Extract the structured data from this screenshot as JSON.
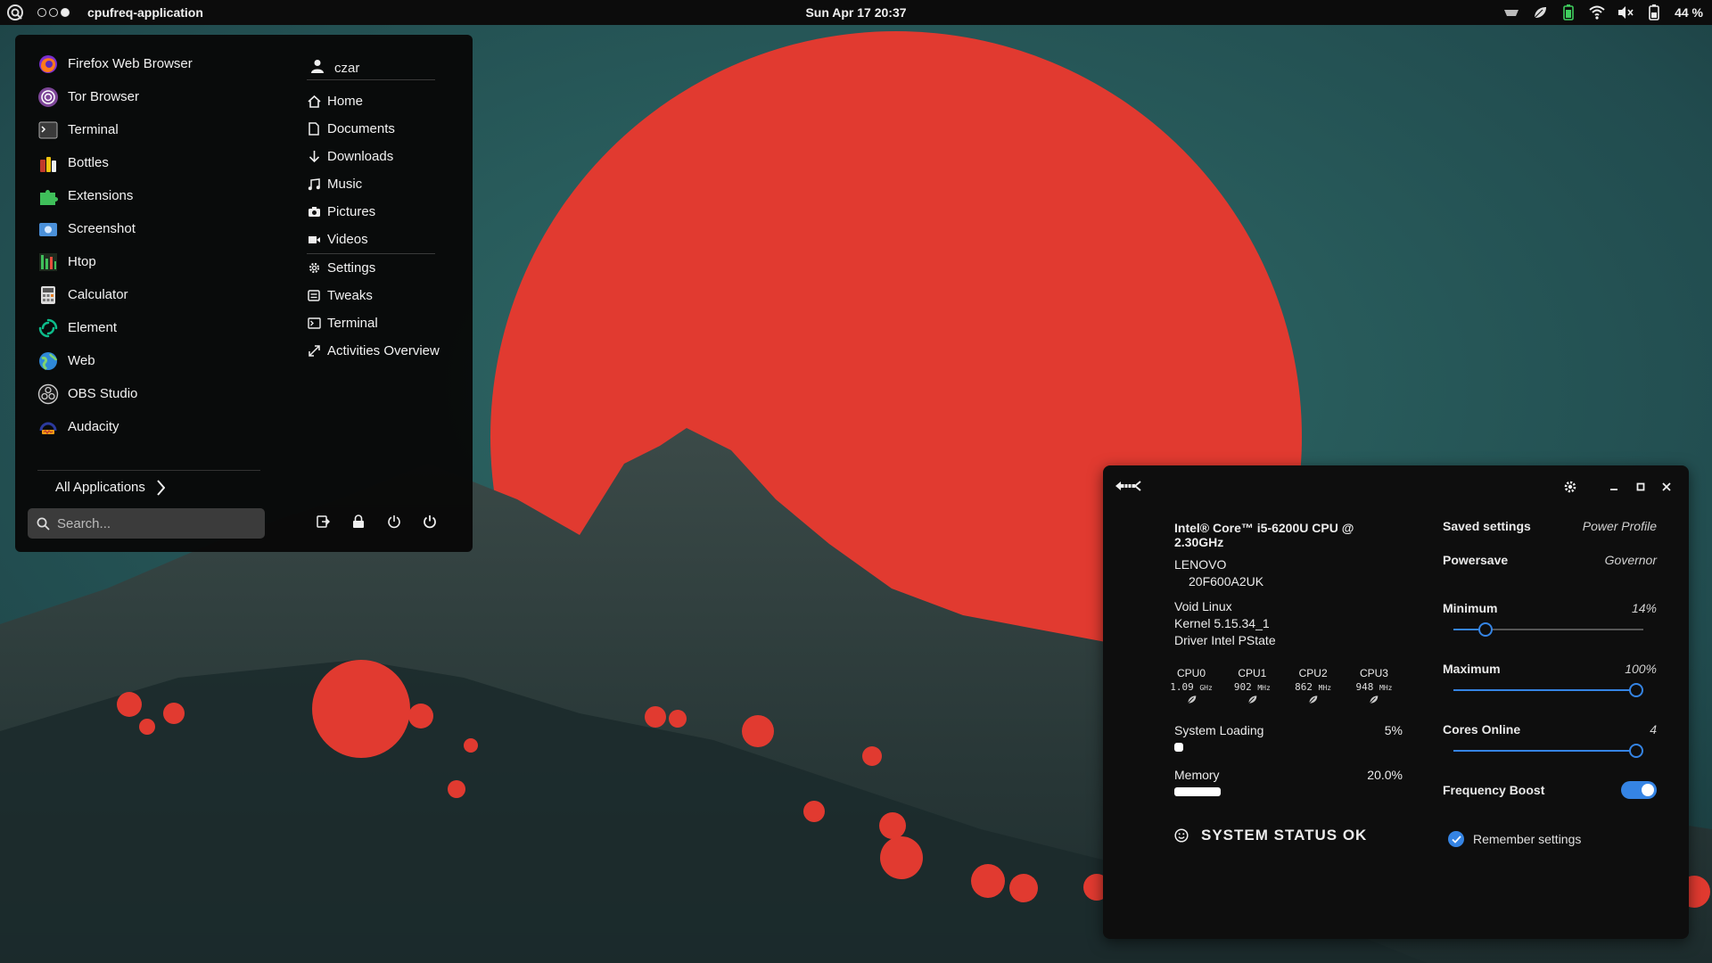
{
  "topbar": {
    "app_name": "cpufreq-application",
    "clock": "Sun Apr 17  20:37",
    "battery_percent": "44 %"
  },
  "appmenu": {
    "apps": [
      {
        "label": "Firefox Web Browser",
        "icon": "firefox-icon"
      },
      {
        "label": "Tor Browser",
        "icon": "tor-browser-icon"
      },
      {
        "label": "Terminal",
        "icon": "terminal-icon"
      },
      {
        "label": "Bottles",
        "icon": "bottles-icon"
      },
      {
        "label": "Extensions",
        "icon": "extensions-icon"
      },
      {
        "label": "Screenshot",
        "icon": "screenshot-icon"
      },
      {
        "label": "Htop",
        "icon": "htop-icon"
      },
      {
        "label": "Calculator",
        "icon": "calculator-icon"
      },
      {
        "label": "Element",
        "icon": "element-icon"
      },
      {
        "label": "Web",
        "icon": "web-icon"
      },
      {
        "label": "OBS Studio",
        "icon": "obs-studio-icon"
      },
      {
        "label": "Audacity",
        "icon": "audacity-icon"
      }
    ],
    "user": "czar",
    "places": [
      {
        "label": "Home",
        "icon": "home-icon"
      },
      {
        "label": "Documents",
        "icon": "document-icon"
      },
      {
        "label": "Downloads",
        "icon": "download-icon"
      },
      {
        "label": "Music",
        "icon": "music-icon"
      },
      {
        "label": "Pictures",
        "icon": "camera-icon"
      },
      {
        "label": "Videos",
        "icon": "video-icon"
      }
    ],
    "system": [
      {
        "label": "Settings",
        "icon": "gear-icon"
      },
      {
        "label": "Tweaks",
        "icon": "tweaks-icon"
      },
      {
        "label": "Terminal",
        "icon": "terminal-icon"
      },
      {
        "label": "Activities Overview",
        "icon": "expand-icon"
      }
    ],
    "all_apps_label": "All Applications",
    "search_placeholder": "Search..."
  },
  "cpufreq": {
    "cpu_model": "Intel® Core™ i5-6200U CPU @ 2.30GHz",
    "vendor": "LENOVO",
    "model": "20F600A2UK",
    "os": "Void Linux",
    "kernel": "Kernel 5.15.34_1",
    "driver": "Driver Intel PState",
    "cores": [
      {
        "name": "CPU0",
        "freq": "1.09",
        "unit": "GHz"
      },
      {
        "name": "CPU1",
        "freq": "902",
        "unit": "MHz"
      },
      {
        "name": "CPU2",
        "freq": "862",
        "unit": "MHz"
      },
      {
        "name": "CPU3",
        "freq": "948",
        "unit": "MHz"
      }
    ],
    "loading_label": "System Loading",
    "loading_value": "5%",
    "loading_fraction": 0.05,
    "memory_label": "Memory",
    "memory_value": "20.0%",
    "memory_fraction": 0.2,
    "status": "SYSTEM STATUS OK",
    "saved_settings_label": "Saved settings",
    "saved_settings_value": "Power Profile",
    "governor_label": "Powersave",
    "governor_value": "Governor",
    "min_label": "Minimum",
    "min_value": "14%",
    "min_fraction": 0.14,
    "max_label": "Maximum",
    "max_value": "100%",
    "max_fraction": 1.0,
    "cores_online_label": "Cores Online",
    "cores_online_value": "4",
    "cores_online_fraction": 1.0,
    "boost_label": "Frequency Boost",
    "boost_on": true,
    "remember_label": "Remember settings",
    "remember_checked": true
  },
  "colors": {
    "accent": "#3584e4",
    "sun": "#e13a30",
    "sky": "#2a5c5c"
  }
}
